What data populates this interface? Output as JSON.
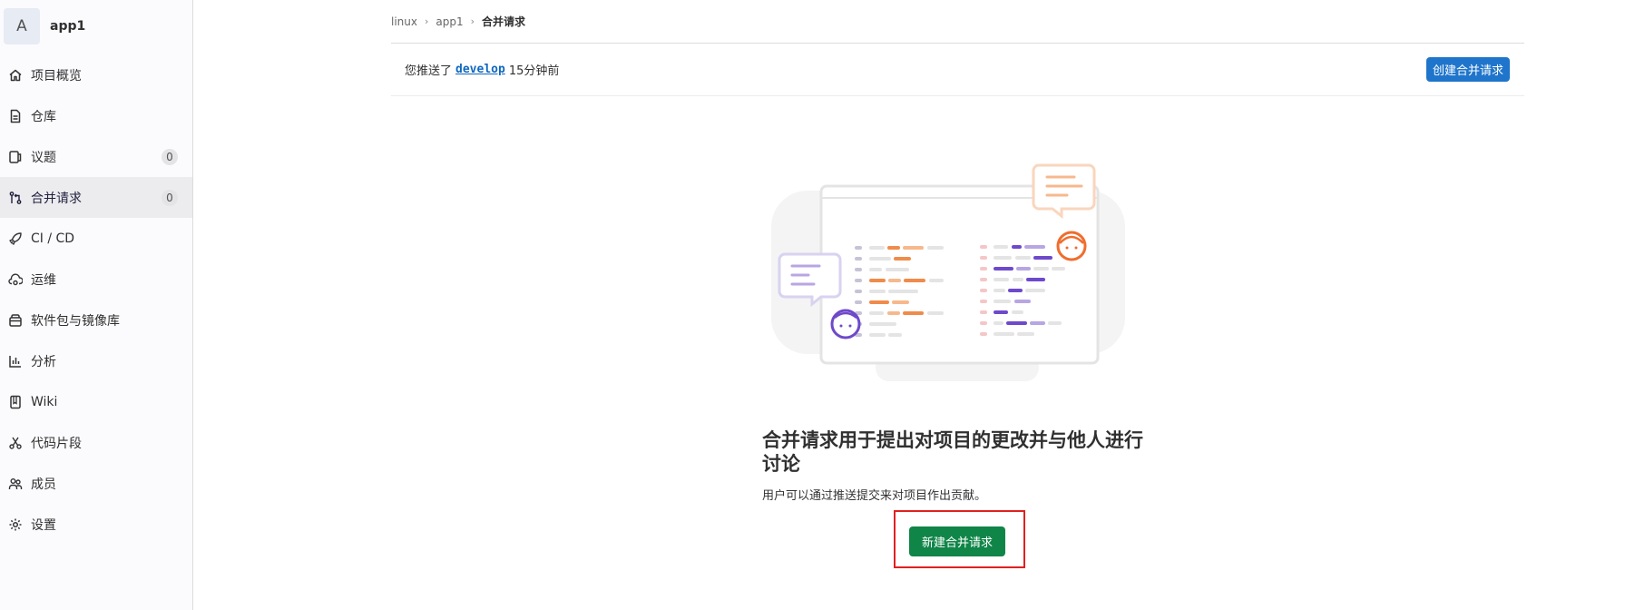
{
  "project": {
    "avatar_letter": "A",
    "name": "app1"
  },
  "sidebar": {
    "items": [
      {
        "label": "项目概览",
        "icon": "home-icon"
      },
      {
        "label": "仓库",
        "icon": "document-icon"
      },
      {
        "label": "议题",
        "icon": "issues-icon",
        "badge": "0"
      },
      {
        "label": "合并请求",
        "icon": "merge-request-icon",
        "badge": "0",
        "active": true
      },
      {
        "label": "CI / CD",
        "icon": "rocket-icon"
      },
      {
        "label": "运维",
        "icon": "cloud-gear-icon"
      },
      {
        "label": "软件包与镜像库",
        "icon": "package-icon"
      },
      {
        "label": "分析",
        "icon": "chart-icon"
      },
      {
        "label": "Wiki",
        "icon": "book-icon"
      },
      {
        "label": "代码片段",
        "icon": "scissors-icon"
      },
      {
        "label": "成员",
        "icon": "users-icon"
      },
      {
        "label": "设置",
        "icon": "settings-icon"
      }
    ]
  },
  "breadcrumb": {
    "items": [
      "linux",
      "app1"
    ],
    "current": "合并请求"
  },
  "push_notice": {
    "prefix": "您推送了",
    "branch": "develop",
    "suffix": "15分钟前",
    "button": "创建合并请求"
  },
  "empty_state": {
    "title": "合并请求用于提出对项目的更改并与他人进行讨论",
    "description": "用户可以通过推送提交来对项目作出贡献。",
    "button": "新建合并请求"
  },
  "colors": {
    "accent": "#1f75cb",
    "success": "#108548",
    "highlight": "#e02020"
  }
}
